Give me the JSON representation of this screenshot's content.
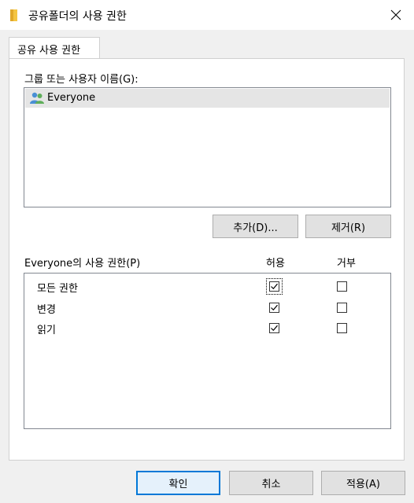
{
  "window": {
    "title": "공유폴더의 사용 권한"
  },
  "tabs": [
    {
      "label": "공유 사용 권한"
    }
  ],
  "groups": {
    "label": "그룹 또는 사용자 이름(G):",
    "users": [
      {
        "name": "Everyone"
      }
    ]
  },
  "actions": {
    "add": "추가(D)...",
    "remove": "제거(R)"
  },
  "permissions": {
    "label": "Everyone의 사용 권한(P)",
    "allow_header": "허용",
    "deny_header": "거부",
    "rows": [
      {
        "name": "모든 권한",
        "allow": true,
        "deny": false
      },
      {
        "name": "변경",
        "allow": true,
        "deny": false
      },
      {
        "name": "읽기",
        "allow": true,
        "deny": false
      }
    ]
  },
  "footer": {
    "ok": "확인",
    "cancel": "취소",
    "apply": "적용(A)"
  },
  "colors": {
    "accent": "#0078d7",
    "folder": "#f4c542"
  }
}
